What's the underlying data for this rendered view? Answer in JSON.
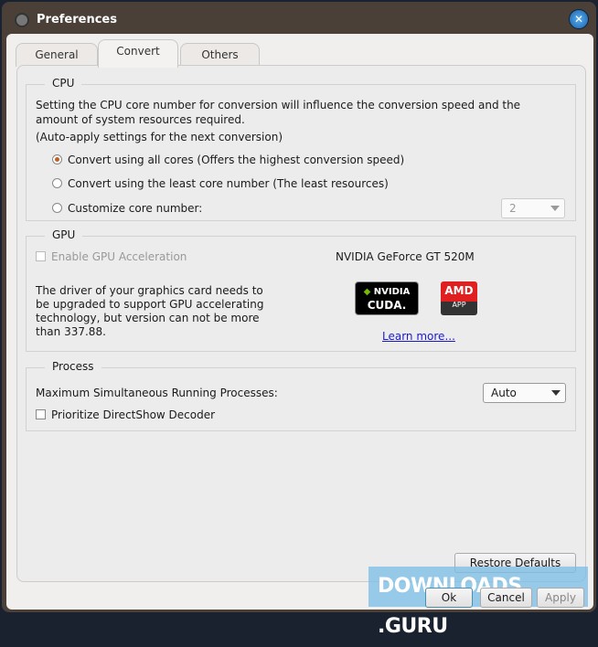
{
  "window": {
    "title": "Preferences"
  },
  "tabs": [
    {
      "label": "General"
    },
    {
      "label": "Convert"
    },
    {
      "label": "Others"
    }
  ],
  "cpu": {
    "legend": "CPU",
    "description": "Setting the CPU core number for conversion will influence the conversion speed and the amount of system resources required.",
    "auto_apply": "(Auto-apply settings for the next conversion)",
    "options": [
      {
        "label": "Convert using all cores (Offers the highest conversion speed)",
        "selected": true
      },
      {
        "label": "Convert using the least core number (The least resources)",
        "selected": false
      },
      {
        "label": "Customize core number:",
        "selected": false
      }
    ],
    "core_number": "2"
  },
  "gpu": {
    "legend": "GPU",
    "enable_label": "Enable GPU Acceleration",
    "card_name": "NVIDIA GeForce GT 520M",
    "driver_message": "The driver of your graphics card needs to be upgraded to support GPU accelerating technology, but version can not be more than 337.88.",
    "nvidia_logo": "NVIDIA CUDA",
    "amd_logo": "AMD APP",
    "learn_more": "Learn more..."
  },
  "process": {
    "legend": "Process",
    "max_label": "Maximum Simultaneous Running Processes:",
    "max_value": "Auto",
    "directshow_label": "Prioritize DirectShow Decoder"
  },
  "buttons": {
    "restore": "Restore Defaults",
    "ok": "Ok",
    "cancel": "Cancel",
    "apply": "Apply"
  },
  "watermark": "DOWNLOADS .GURU"
}
